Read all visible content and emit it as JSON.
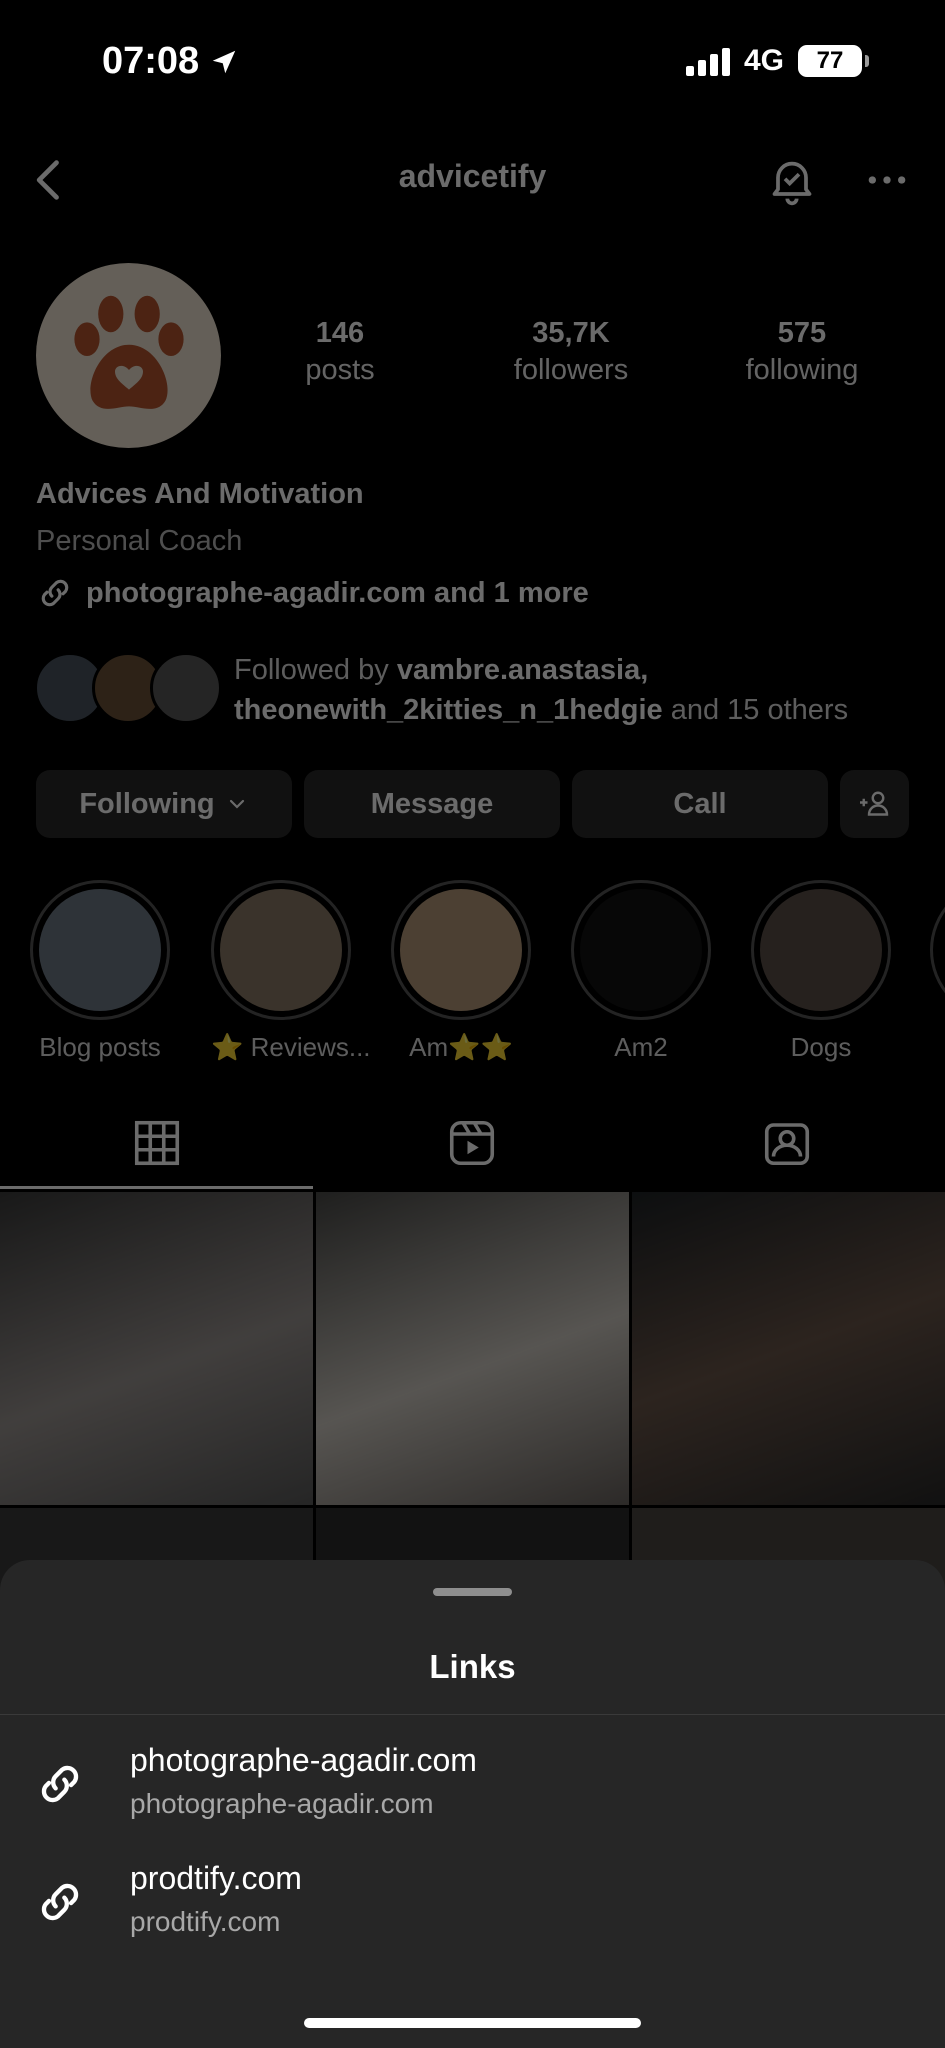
{
  "status_bar": {
    "time": "07:08",
    "network": "4G",
    "battery": "77"
  },
  "profile": {
    "username": "advicetify",
    "avatar_icon": "paw-icon",
    "stats": [
      {
        "value": "146",
        "label": "posts"
      },
      {
        "value": "35,7K",
        "label": "followers"
      },
      {
        "value": "575",
        "label": "following"
      }
    ],
    "name": "Advices And Motivation",
    "category": "Personal Coach",
    "link_text": "photographe-agadir.com and 1 more",
    "followed_by_prefix": "Followed by ",
    "followed_user_1": "vambre.anastasia,",
    "followed_user_2": "theonewith_2kitties_n_1hedgie",
    "followed_suffix": " and 15 others"
  },
  "actions": {
    "following": "Following",
    "message": "Message",
    "call": "Call"
  },
  "highlights": [
    {
      "label": "Blog posts",
      "color": "#6f7a86"
    },
    {
      "label": "⭐ Reviews...",
      "color": "#8a7a66"
    },
    {
      "label": "Am⭐⭐",
      "color": "#b59a7a"
    },
    {
      "label": "Am2",
      "color": "#111111"
    },
    {
      "label": "Dogs",
      "color": "#5c5048"
    }
  ],
  "links_sheet": {
    "title": "Links",
    "links": [
      {
        "title": "photographe-agadir.com",
        "url": "photographe-agadir.com"
      },
      {
        "title": "prodtify.com",
        "url": "prodtify.com"
      }
    ]
  },
  "colors": {
    "background": "#000000",
    "sheet": "#262626",
    "button": "#2a2a2a",
    "paw": "#b5532e"
  }
}
